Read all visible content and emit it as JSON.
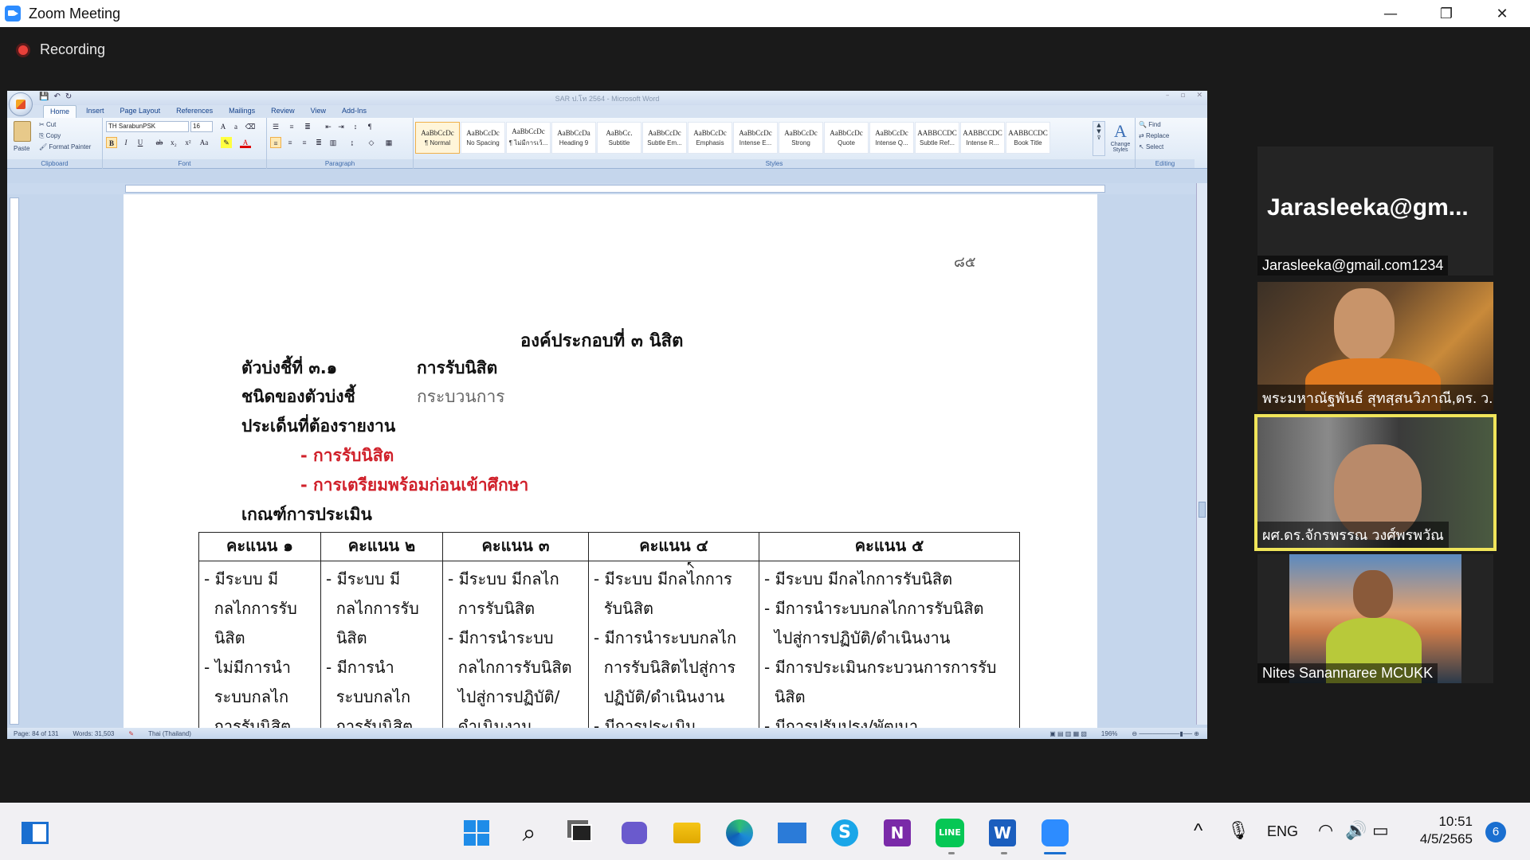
{
  "zoom": {
    "title": "Zoom Meeting",
    "recording_label": "Recording",
    "controls": {
      "minimize": "—",
      "restore": "❐",
      "close": "✕"
    }
  },
  "word": {
    "doc_title": "SAR ป.โท 2564 - Microsoft Word",
    "tabs": [
      "Home",
      "Insert",
      "Page Layout",
      "References",
      "Mailings",
      "Review",
      "View",
      "Add-Ins"
    ],
    "clipboard": {
      "paste": "Paste",
      "cut": "Cut",
      "copy": "Copy",
      "format_painter": "Format Painter",
      "label": "Clipboard"
    },
    "font": {
      "name": "TH SarabunPSK",
      "size": "16",
      "label": "Font"
    },
    "paragraph_label": "Paragraph",
    "styles": [
      {
        "sample": "AaBbCcDc",
        "name": "¶ Normal"
      },
      {
        "sample": "AaBbCcDc",
        "name": "No Spacing"
      },
      {
        "sample": "AaBbCcDc",
        "name": "¶ ไม่มีการเว้..."
      },
      {
        "sample": "AaBbCcDa",
        "name": "Heading 9"
      },
      {
        "sample": "AaBbCc.",
        "name": "Subtitle"
      },
      {
        "sample": "AaBbCcDc",
        "name": "Subtle Em..."
      },
      {
        "sample": "AaBbCcDc",
        "name": "Emphasis"
      },
      {
        "sample": "AaBbCcDc",
        "name": "Intense E..."
      },
      {
        "sample": "AaBbCcDc",
        "name": "Strong"
      },
      {
        "sample": "AaBbCcDc",
        "name": "Quote"
      },
      {
        "sample": "AaBbCcDc",
        "name": "Intense Q..."
      },
      {
        "sample": "AABBCCDC",
        "name": "Subtle Ref..."
      },
      {
        "sample": "AABBCCDC",
        "name": "Intense R..."
      },
      {
        "sample": "AABBCCDC",
        "name": "Book Title"
      }
    ],
    "styles_label": "Styles",
    "change_styles": "Change Styles",
    "editing": {
      "find": "Find",
      "replace": "Replace",
      "select": "Select",
      "label": "Editing"
    },
    "status": {
      "page": "Page: 84 of 131",
      "words": "Words: 31,503",
      "lang": "Thai (Thailand)",
      "zoom": "196%"
    }
  },
  "doc": {
    "page_number": "๘๕",
    "heading": "องค์ประกอบที่ ๓ นิสิต",
    "indicator_label": "ตัวบ่งชี้ที่ ๓.๑",
    "indicator_value": "การรับนิสิต",
    "type_label": "ชนิดของตัวบ่งชี้",
    "type_value": "กระบวนการ",
    "issues_label": "ประเด็นที่ต้องรายงาน",
    "issue1": "- การรับนิสิต",
    "issue2": "- การเตรียมพร้อมก่อนเข้าศึกษา",
    "criteria_label": "เกณฑ์การประเมิน",
    "table": {
      "headers": [
        "คะแนน ๑",
        "คะแนน ๒",
        "คะแนน ๓",
        "คะแนน ๔",
        "คะแนน ๕"
      ],
      "cols": [
        [
          "- มีระบบ มี",
          "  กลไกการรับ",
          "  นิสิต",
          "- ไม่มีการนำ",
          "  ระบบกลไก",
          "  การรับนิสิต"
        ],
        [
          "- มีระบบ มี",
          "  กลไกการรับ",
          "  นิสิต",
          "- มีการนำ",
          "  ระบบกลไก",
          "  การรับนิสิต"
        ],
        [
          "- มีระบบ มีกลไก",
          "  การรับนิสิต",
          "- มีการนำระบบ",
          "  กลไกการรับนิสิต",
          "  ไปสู่การปฏิบัติ/",
          "  ดำเนินงาน"
        ],
        [
          "- มีระบบ มีกลไกการ",
          "  รับนิสิต",
          "- มีการนำระบบกลไก",
          "  การรับนิสิตไปสู่การ",
          "  ปฏิบัติ/ดำเนินงาน",
          "- มีการประเมิน"
        ],
        [
          "- มีระบบ มีกลไกการรับนิสิต",
          "- มีการนำระบบกลไกการรับนิสิต",
          "  ไปสู่การปฏิบัติ/ดำเนินงาน",
          "- มีการประเมินกระบวนการการรับ",
          "  นิสิต",
          "- มีการปรับปรุง/พัฒนา"
        ]
      ]
    }
  },
  "participants": [
    {
      "big_name": "Jarasleeka@gm...",
      "name": "Jarasleeka@gmail.com1234"
    },
    {
      "name": "พระมหาณัฐพันธ์ สุทสฺสนวิภาณี,ดร. ว..."
    },
    {
      "name": "ผศ.ดร.จักรพรรณ วงศ์พรพวัณ"
    },
    {
      "name": "Nites Sanannaree MCUKK"
    }
  ],
  "taskbar": {
    "lang": "ENG",
    "time": "10:51",
    "date": "4/5/2565",
    "notification_count": "6"
  }
}
